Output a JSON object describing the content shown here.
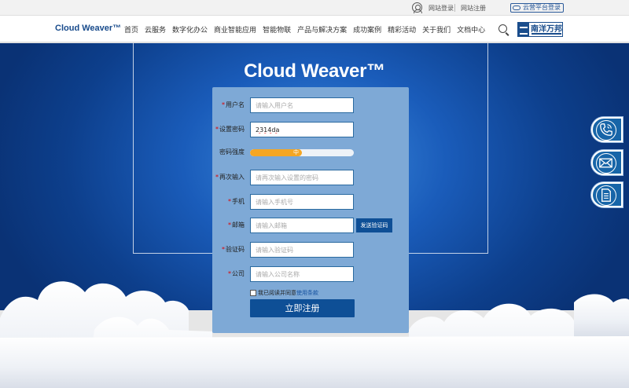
{
  "topbar": {
    "login_label": "网站登录",
    "register_label": "网站注册",
    "cloud_login_label": "云营平台登录"
  },
  "nav": {
    "brand": "Cloud Weaver™",
    "items": [
      "首页",
      "云服务",
      "数字化办公",
      "商业智能应用",
      "智能物联",
      "产品与解决方案",
      "成功案例",
      "精彩活动",
      "关于我们",
      "文档中心"
    ],
    "partner_logo_text": "南洋万邦"
  },
  "hero": {
    "title": "Cloud Weaver™"
  },
  "form": {
    "username": {
      "label": "用户名",
      "required": "*",
      "placeholder": "请输入用户名",
      "value": ""
    },
    "password": {
      "label": "设置密码",
      "required": "*",
      "value": "2314da"
    },
    "strength": {
      "label": "密码强度",
      "level_text": "中",
      "level": 0.5
    },
    "confirm": {
      "label": "再次输入",
      "required": "*",
      "placeholder": "请再次输入设置的密码"
    },
    "phone": {
      "label": "手机",
      "required": "*",
      "placeholder": "请输入手机号"
    },
    "email": {
      "label": "邮箱",
      "required": "*",
      "placeholder": "请输入邮箱"
    },
    "send_code_label": "发送验证码",
    "code": {
      "label": "验证码",
      "required": "*",
      "placeholder": "请输入验证码"
    },
    "company": {
      "label": "公司",
      "required": "*",
      "placeholder": "请输入公司名称"
    },
    "agree_text": "我已阅读并同意",
    "terms_text": "使用条款",
    "submit_label": "立即注册"
  },
  "side": {
    "icons": [
      "phone-icon",
      "mail-icon",
      "document-icon"
    ]
  },
  "colors": {
    "primary": "#0e4f96",
    "panel": "#7ea9d6",
    "strength": "#f5a623",
    "required": "#dd0000"
  }
}
